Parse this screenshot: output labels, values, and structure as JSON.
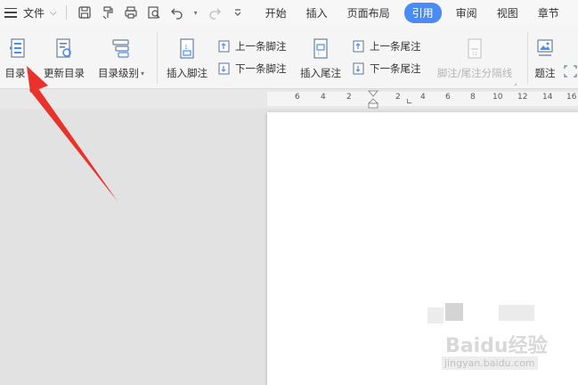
{
  "menubar": {
    "file_label": "文件",
    "tabs": [
      {
        "label": "开始",
        "active": false
      },
      {
        "label": "插入",
        "active": false
      },
      {
        "label": "页面布局",
        "active": false
      },
      {
        "label": "引用",
        "active": true
      },
      {
        "label": "审阅",
        "active": false
      },
      {
        "label": "视图",
        "active": false
      },
      {
        "label": "章节",
        "active": false
      }
    ]
  },
  "ribbon": {
    "toc": "目录",
    "update_toc": "更新目录",
    "toc_level": "目录级别",
    "insert_footnote": "插入脚注",
    "prev_footnote": "上一条脚注",
    "next_footnote": "下一条脚注",
    "insert_endnote": "插入尾注",
    "prev_endnote": "上一条尾注",
    "next_endnote": "下一条尾注",
    "separator_line": "脚注/尾注分隔线",
    "caption": "题注"
  },
  "ruler": {
    "ticks": [
      "6",
      "4",
      "2",
      "2",
      "4",
      "6",
      "8",
      "10",
      "12",
      "14",
      "16"
    ]
  },
  "watermark": {
    "brand": "Baidu经验",
    "url": "jingyan.baidu.com"
  },
  "colors": {
    "accent": "#4a8bf5",
    "annotation": "#e8322b"
  }
}
